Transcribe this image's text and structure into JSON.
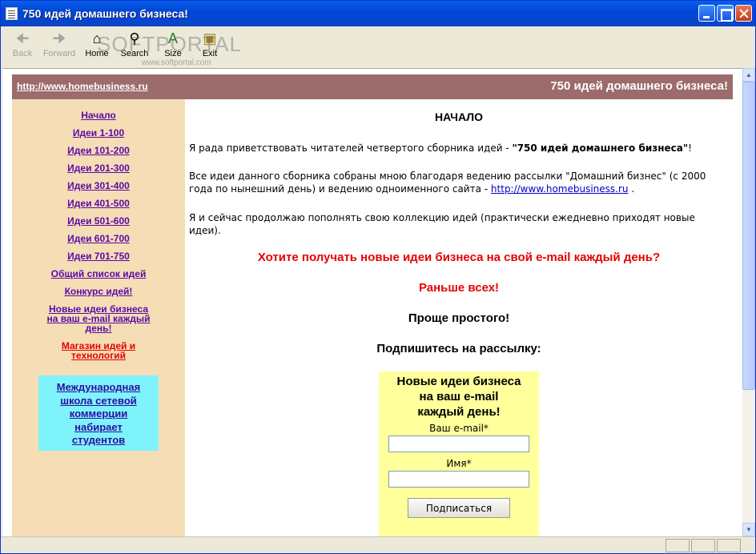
{
  "window": {
    "title": "750 идей домашнего бизнеса!"
  },
  "toolbar": {
    "back": "Back",
    "forward": "Forward",
    "home": "Home",
    "search": "Search",
    "size": "Size",
    "exit": "Exit"
  },
  "watermark": {
    "text": "SOFTPORTAL",
    "sub": "www.softportal.com"
  },
  "banner": {
    "url": "http://www.homebusiness.ru",
    "title": "750 идей домашнего бизнеса!"
  },
  "nav": {
    "items": [
      "Начало",
      "Идеи 1-100",
      "Идеи 101-200",
      "Идеи 201-300",
      "Идеи 301-400",
      "Идеи 401-500",
      "Идеи 501-600",
      "Идеи 601-700",
      "Идеи 701-750",
      "Общий список идей",
      "Конкурс идей!"
    ],
    "new_ideas": [
      "Новые идеи бизнеса",
      "на ваш e-mail каждый",
      "день!"
    ],
    "shop": [
      "Магазин идей и",
      "технологий"
    ]
  },
  "promo": {
    "lines": [
      "Международная",
      "школа сетевой",
      "коммерции",
      "набирает",
      "студентов"
    ]
  },
  "main": {
    "heading": "НАЧАЛО",
    "p1_text": "Я рада приветствовать читателей четвертого сборника идей - ",
    "p1_bold": "\"750 идей домашнего бизнеса\"",
    "p1_end": "!",
    "p2_text": "Все идеи данного сборника собраны мною благодаря ведению рассылки \"Домашний бизнес\" (с 2000 года по нынешний день) и ведению одноименного сайта - ",
    "p2_link": "http://www.homebusiness.ru",
    "p2_end": " .",
    "p3_text": "Я и сейчас продолжаю пополнять свою коллекцию идей (практически ежедневно приходят новые идеи).",
    "cta_red": "Хотите получать новые идеи бизнеса на свой e-mail каждый день?",
    "earlier": "Раньше всех!",
    "simple": "Проще простого!",
    "subscribe_prompt": "Подпишитесь на рассылку:"
  },
  "form": {
    "title": [
      "Новые идеи бизнеса",
      "на ваш e-mail",
      "каждый день!"
    ],
    "email_label": "Ваш e-mail*",
    "email_value": "",
    "name_label": "Имя*",
    "name_value": "",
    "submit": "Подписаться"
  },
  "colors": {
    "banner_bg": "#9c6b6b",
    "sidebar_bg": "#f5ddb5",
    "promo_bg": "#7ff3fb",
    "form_bg": "#ffff9c",
    "link": "#5a0aa8",
    "accent_red": "#e60000"
  }
}
